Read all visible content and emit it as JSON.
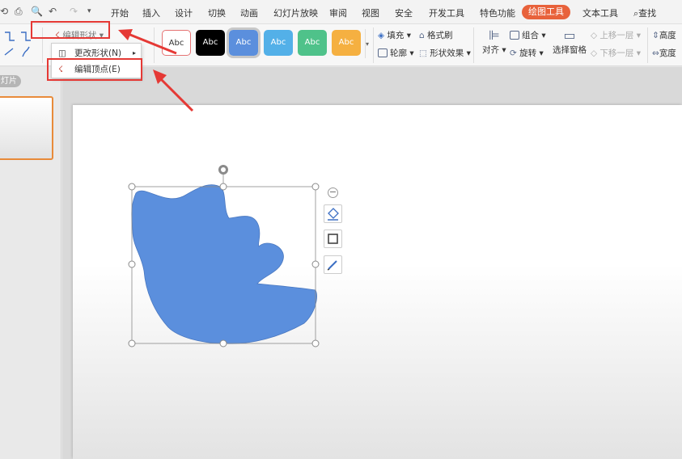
{
  "menubar": {
    "items": [
      "开始",
      "插入",
      "设计",
      "切换",
      "动画",
      "幻灯片放映",
      "审阅",
      "视图",
      "安全",
      "开发工具",
      "特色功能"
    ],
    "active_tab": "绘图工具",
    "text_tools": "文本工具",
    "search": "查找"
  },
  "ribbon": {
    "edit_shape": "编辑形状",
    "styles": [
      "Abc",
      "Abc",
      "Abc",
      "Abc",
      "Abc",
      "Abc"
    ],
    "fill": "填充",
    "outline": "轮廓",
    "format_painter": "格式刷",
    "shape_effects": "形状效果",
    "align": "对齐",
    "group": "组合",
    "rotate": "旋转",
    "selection_pane": "选择窗格",
    "bring_forward": "上移一层",
    "send_backward": "下移一层",
    "height": "高度",
    "width": "宽度"
  },
  "dropdown": {
    "change_shape": "更改形状(N)",
    "edit_points": "编辑顶点(E)"
  },
  "left_panel": {
    "slides_tab": "灯片"
  },
  "colors": {
    "accent_orange": "#e8623b",
    "shape_fill": "#5b8fdd",
    "annotation_red": "#e53935"
  }
}
